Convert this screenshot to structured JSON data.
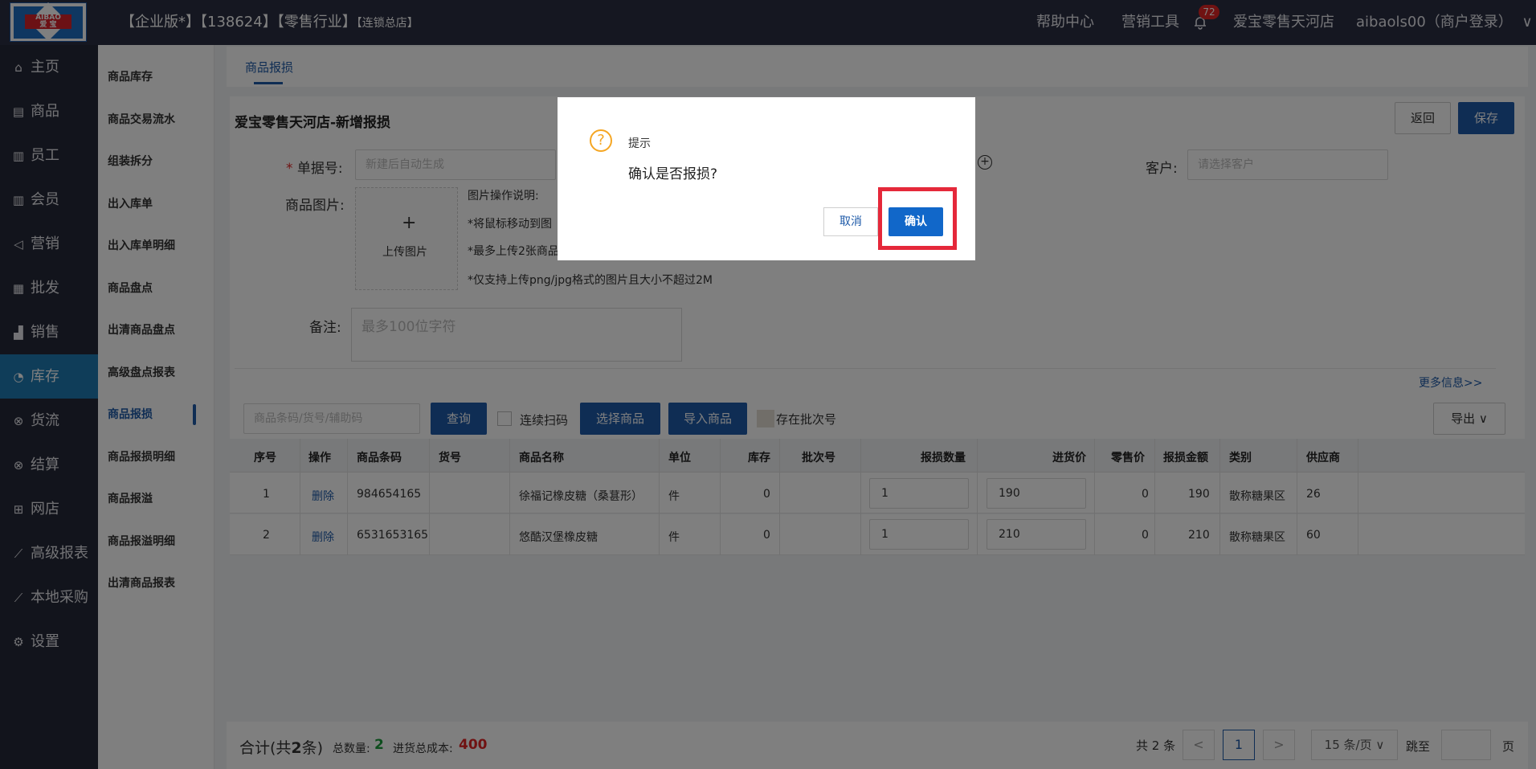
{
  "header": {
    "logo_text_top": "AIBAO",
    "logo_text_bottom": "爱 宝",
    "title_main": "【企业版*】【138624】【零售行业】",
    "title_small": "【连锁总店】",
    "help": "帮助中心",
    "marketing_tool": "营销工具",
    "notification_count": "72",
    "store": "爱宝零售天河店",
    "user": "aibaols00（商户登录）",
    "user_chevron": "∨"
  },
  "leftnav": {
    "items": [
      {
        "icon": "⌂",
        "label": "主页"
      },
      {
        "icon": "▤",
        "label": "商品"
      },
      {
        "icon": "▥",
        "label": "员工"
      },
      {
        "icon": "▥",
        "label": "会员"
      },
      {
        "icon": "◁",
        "label": "营销"
      },
      {
        "icon": "▦",
        "label": "批发"
      },
      {
        "icon": "▟",
        "label": "销售"
      },
      {
        "icon": "◔",
        "label": "库存"
      },
      {
        "icon": "⊗",
        "label": "货流"
      },
      {
        "icon": "⊗",
        "label": "结算"
      },
      {
        "icon": "⊞",
        "label": "网店"
      },
      {
        "icon": "⟋",
        "label": "高级报表"
      },
      {
        "icon": "⟋",
        "label": "本地采购"
      },
      {
        "icon": "⚙",
        "label": "设置"
      }
    ],
    "active_index": 7
  },
  "subnav": {
    "items": [
      "商品库存",
      "商品交易流水",
      "组装拆分",
      "出入库单",
      "出入库单明细",
      "商品盘点",
      "出清商品盘点",
      "高级盘点报表",
      "商品报损",
      "商品报损明细",
      "商品报溢",
      "商品报溢明细",
      "出清商品报表"
    ],
    "active_index": 8
  },
  "tabs": {
    "active": "商品报损"
  },
  "panel": {
    "title": "爱宝零售天河店-新增报损",
    "back_label": "返回",
    "save_label": "保存",
    "order_no_label": "单据号:",
    "order_no_placeholder": "新建后自动生成",
    "customer_label": "客户:",
    "customer_placeholder": "请选择客户",
    "image_label": "商品图片:",
    "upload_plus": "+",
    "upload_text": "上传图片",
    "notes": [
      "图片操作说明:",
      "*将鼠标移动到图",
      "*最多上传2张商品",
      "*仅支持上传png/jpg格式的图片且大小不超过2M"
    ],
    "remark_label": "备注:",
    "remark_placeholder": "最多100位字符",
    "more_info": "更多信息>>"
  },
  "toolbar": {
    "search_placeholder": "商品条码/货号/辅助码",
    "query_label": "查询",
    "continuous_scan": "连续扫码",
    "select_goods": "选择商品",
    "import_goods": "导入商品",
    "batch_label": "存在批次号",
    "export_label": "导出",
    "export_chevron": "∨"
  },
  "table": {
    "headers": [
      "序号",
      "操作",
      "商品条码",
      "货号",
      "商品名称",
      "单位",
      "库存",
      "批次号",
      "报损数量",
      "进货价",
      "零售价",
      "报损金额",
      "类别",
      "供应商"
    ],
    "rows": [
      {
        "no": "1",
        "op": "删除",
        "barcode": "984654165",
        "item_no": "",
        "name": "徐福记橡皮糖（桑葚形）",
        "unit": "件",
        "stock": "0",
        "batch": "",
        "qty": "1",
        "cost": "190",
        "retail": "0",
        "amount": "190",
        "category": "散称糖果区",
        "supplier": "26"
      },
      {
        "no": "2",
        "op": "删除",
        "barcode": "6531653165",
        "item_no": "",
        "name": "悠酷汉堡橡皮糖",
        "unit": "件",
        "stock": "0",
        "batch": "",
        "qty": "1",
        "cost": "210",
        "retail": "0",
        "amount": "210",
        "category": "散称糖果区",
        "supplier": "60"
      }
    ]
  },
  "footer": {
    "total_prefix": "合计(共",
    "total_count": "2",
    "total_suffix": "条)",
    "qty_label": "总数量:",
    "qty_value": "2",
    "cost_label": "进货总成本:",
    "cost_value": "400",
    "page_total": "共 2 条",
    "prev": "<",
    "current_page": "1",
    "next": ">",
    "page_size": "15 条/页",
    "page_size_chevron": "∨",
    "jump_label": "跳至",
    "page_unit": "页"
  },
  "dialog": {
    "icon": "?",
    "title": "提示",
    "message": "确认是否报损?",
    "cancel": "取消",
    "confirm": "确认"
  },
  "colors": {
    "header_bg": "#2b2f43",
    "nav_bg": "#252938",
    "active_blue": "#1e7ab3",
    "primary": "#1e5aa8",
    "highlight": "#e5283a",
    "warning": "#f5a623"
  }
}
